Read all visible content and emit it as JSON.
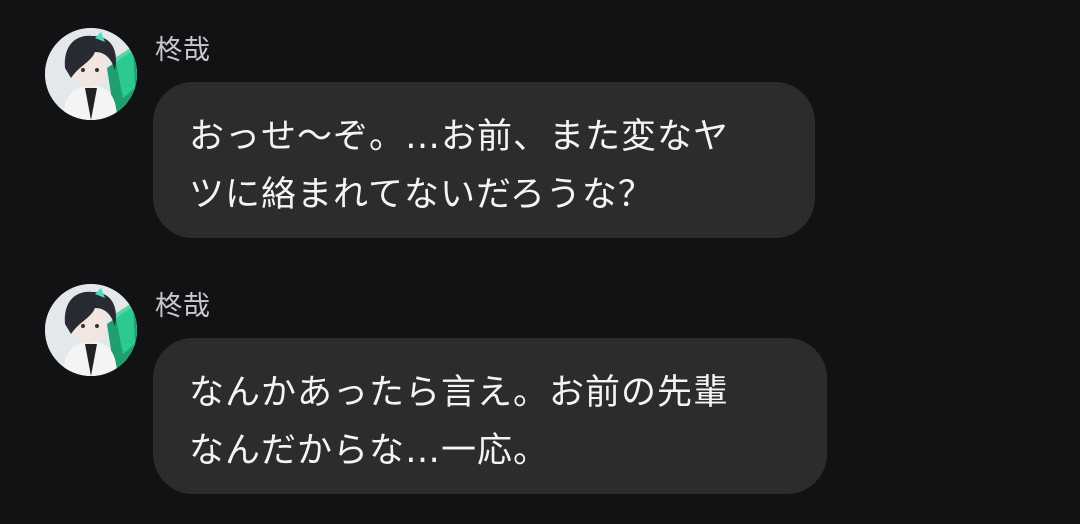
{
  "messages": [
    {
      "sender": "柊哉",
      "text": "おっせ〜ぞ。…お前、また変なヤ\nツに絡まれてないだろうな？"
    },
    {
      "sender": "柊哉",
      "text": "なんかあったら言え。お前の先輩\nなんだからな…一応。"
    }
  ]
}
